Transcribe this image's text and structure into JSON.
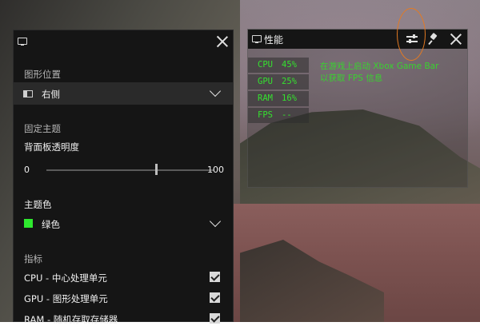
{
  "colors": {
    "accent_green": "#35e12f",
    "annotation_orange": "#e47a22",
    "panel_bg": "#151515"
  },
  "settings_panel": {
    "header_icon": "widget-icon",
    "close_icon": "close-icon",
    "graph_position_label": "图形位置",
    "graph_position_value": "右侧",
    "pin_theme_label": "固定主题",
    "opacity_label": "背面板透明度",
    "opacity_min": "0",
    "opacity_max": "100",
    "opacity_value_pct": 65,
    "theme_color_label": "主题色",
    "theme_color_value": "绿色",
    "theme_color_swatch": "#2ee82e",
    "metrics_label": "指标",
    "metrics": [
      {
        "label": "CPU - 中心处理单元",
        "checked": true
      },
      {
        "label": "GPU - 图形处理单元",
        "checked": true
      },
      {
        "label": "RAM - 随机存取存储器",
        "checked": true
      }
    ]
  },
  "performance_widget": {
    "title": "性能",
    "icons": [
      "widget-icon",
      "settings-sliders-icon",
      "pin-icon",
      "close-icon"
    ],
    "stats": [
      {
        "name": "CPU",
        "value": "45%"
      },
      {
        "name": "GPU",
        "value": "25%"
      },
      {
        "name": "RAM",
        "value": "16%"
      },
      {
        "name": "FPS",
        "value": "--"
      }
    ],
    "hint_line1": "在游戏上启动 Xbox Game Bar",
    "hint_line2": "以获取 FPS 信息"
  }
}
